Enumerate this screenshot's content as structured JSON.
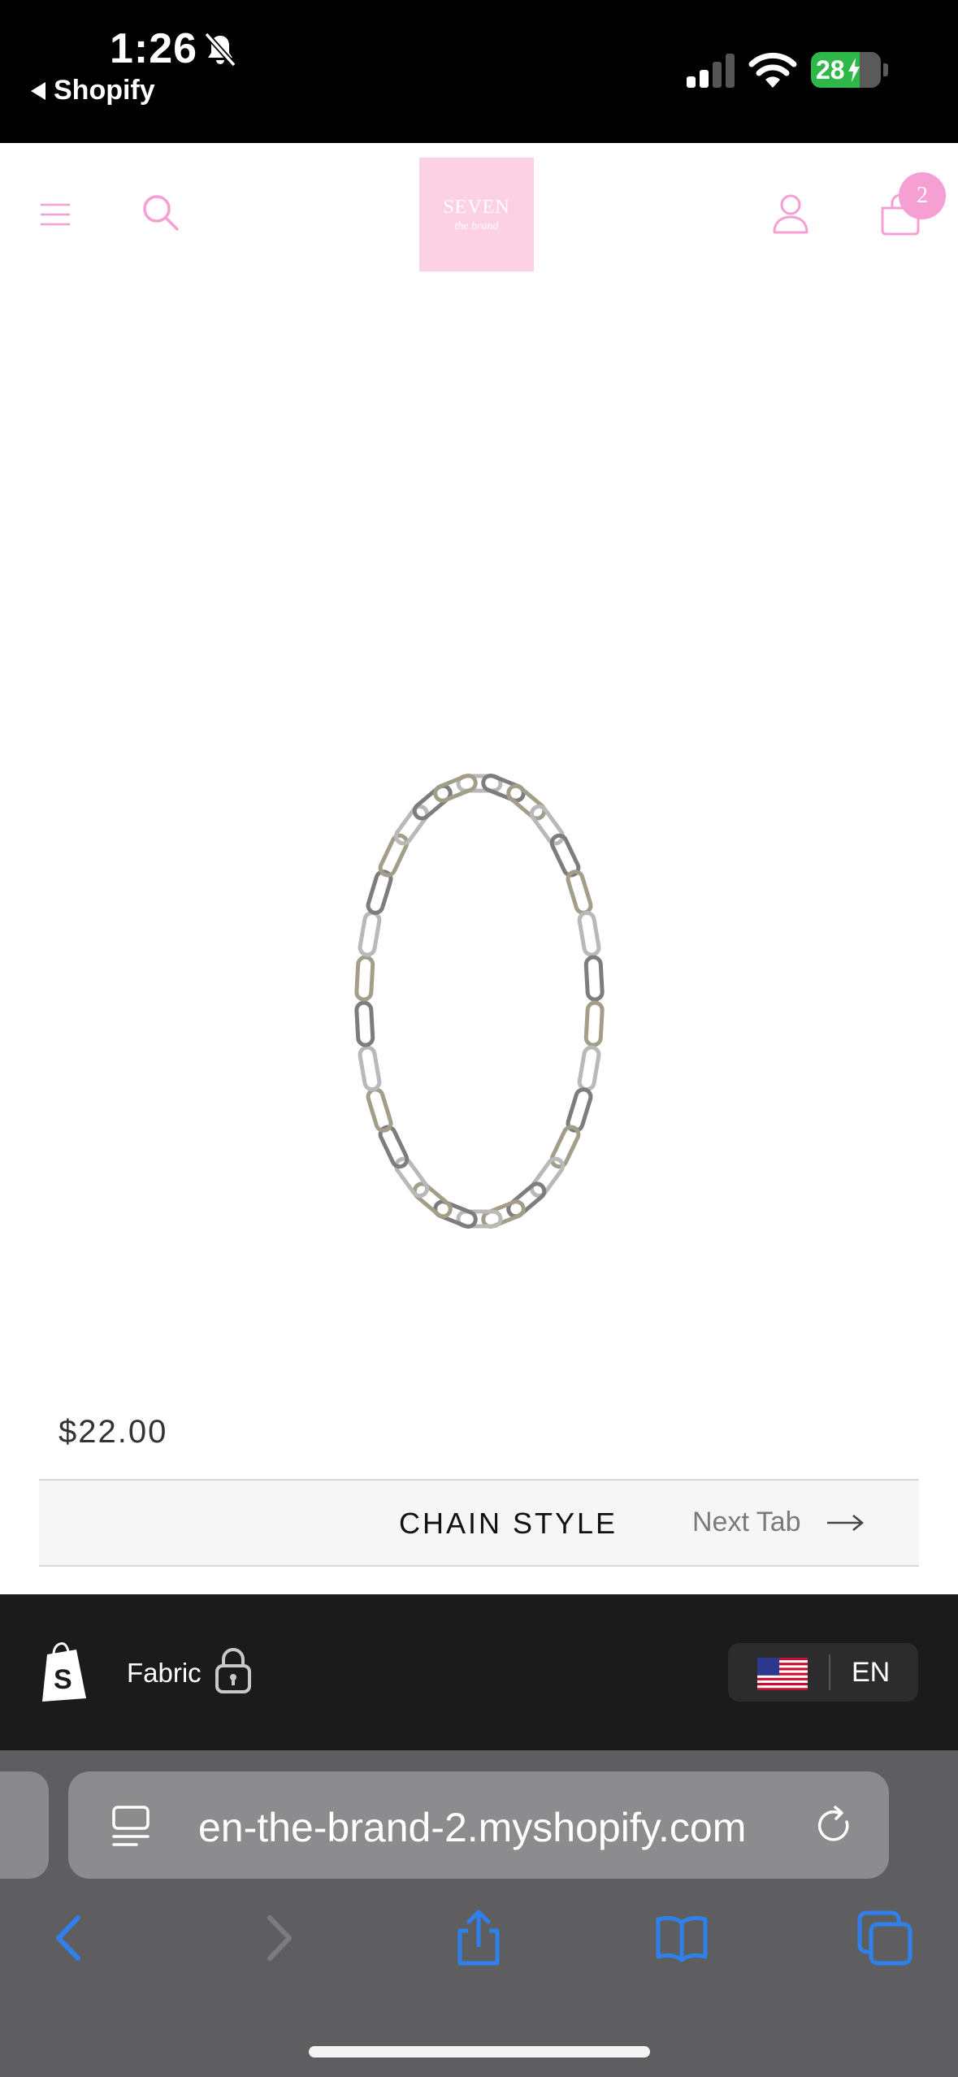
{
  "status_bar": {
    "time": "1:26",
    "back_app": "Shopify",
    "battery": "28"
  },
  "header": {
    "logo_text": "SEVEN",
    "logo_subtext": "the brand",
    "cart_count": "2"
  },
  "product": {
    "price": "$22.00",
    "tab_title": "CHAIN STYLE",
    "next_tab_label": "Next Tab"
  },
  "fabric_bar": {
    "label": "Fabric",
    "language": "EN"
  },
  "browser": {
    "url": "en-the-brand-2.myshopify.com"
  },
  "colors": {
    "brand_pink": "#f59fd3",
    "logo_bg": "#fbd1e3",
    "ios_blue": "#2f80ed"
  }
}
